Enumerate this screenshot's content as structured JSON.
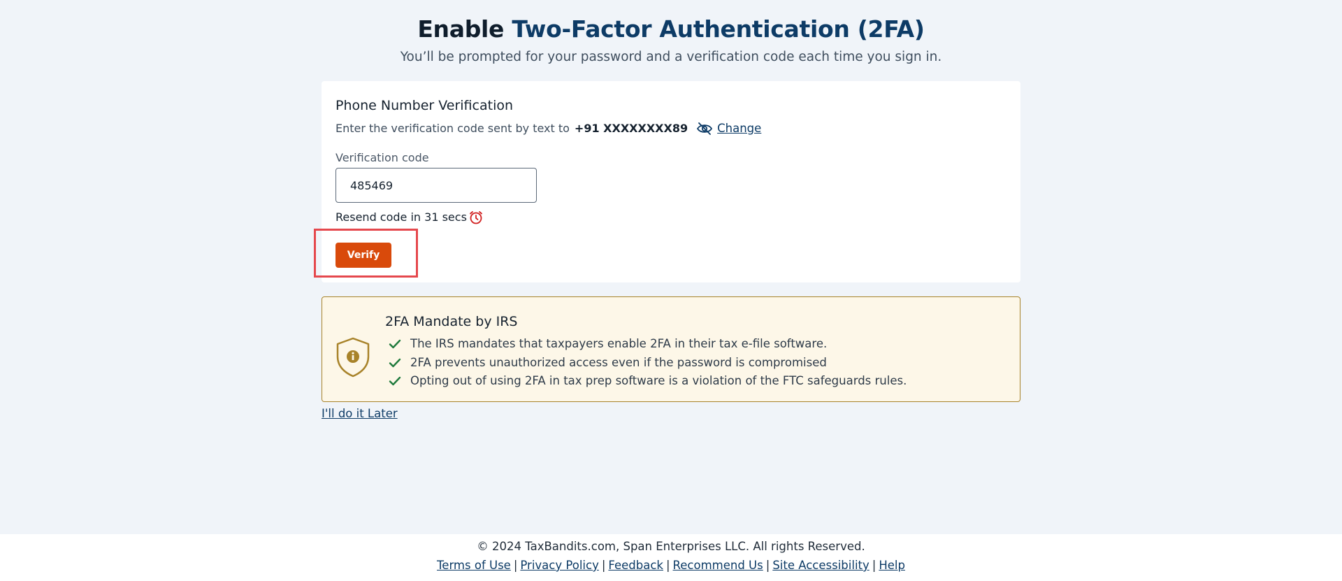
{
  "header": {
    "title_part1": "Enable",
    "title_part2": "Two-Factor Authentication (2FA)",
    "subtitle": "You’ll be prompted for your password and a verification code each time you sign in."
  },
  "verification": {
    "title": "Phone Number Verification",
    "instruction": "Enter the verification code sent by text to",
    "phone": "+91 XXXXXXXX89",
    "change_label": "Change",
    "code_label": "Verification code",
    "code_value": "485469",
    "resend_text": "Resend code in 31 secs",
    "verify_label": "Verify"
  },
  "mandate": {
    "title": "2FA Mandate by IRS",
    "items": [
      "The IRS mandates that taxpayers enable 2FA in their tax e-file software.",
      "2FA prevents unauthorized access even if the password is compromised",
      "Opting out of using 2FA in tax prep software is a violation of the FTC safeguards rules."
    ]
  },
  "later_link": "I'll do it Later",
  "footer": {
    "copyright": "© 2024 TaxBandits.com, Span Enterprises LLC. All rights Reserved.",
    "links": [
      "Terms of Use",
      "Privacy Policy",
      "Feedback",
      "Recommend Us",
      "Site Accessibility",
      "Help"
    ],
    "separator": "|"
  },
  "colors": {
    "accent_orange": "#d94a0b",
    "navy": "#0d3b66",
    "highlight_red": "#e5484d",
    "mandate_bg": "#fdf7e8",
    "mandate_border": "#a8832a",
    "check_green": "#1e7a3c"
  },
  "icons": {
    "eye": "eye-slash-icon",
    "clock": "alarm-clock-icon",
    "shield": "shield-info-icon",
    "check": "check-icon"
  }
}
